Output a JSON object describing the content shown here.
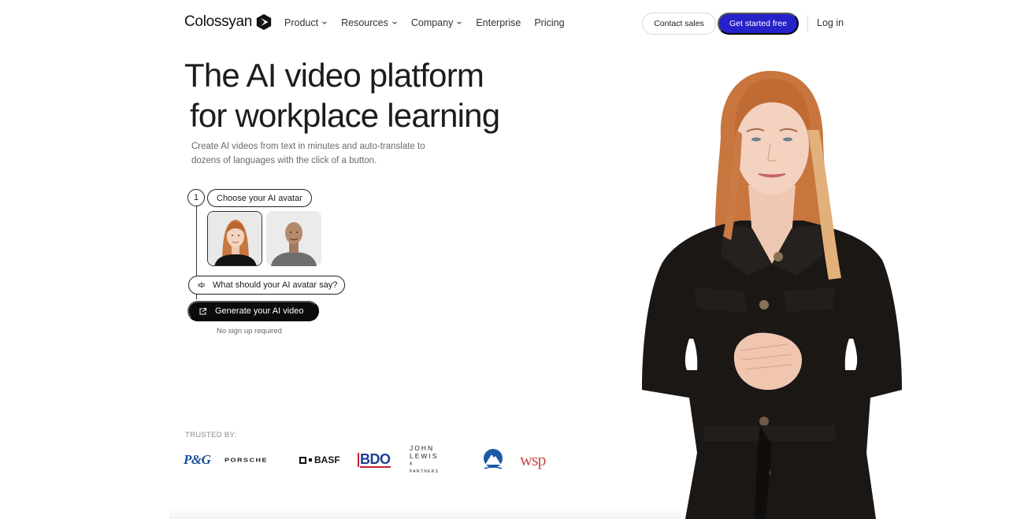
{
  "nav": {
    "brand": "Colossyan",
    "links": [
      {
        "label": "Product",
        "has_dropdown": true
      },
      {
        "label": "Resources",
        "has_dropdown": true
      },
      {
        "label": "Company",
        "has_dropdown": true
      },
      {
        "label": "Enterprise",
        "has_dropdown": false
      },
      {
        "label": "Pricing",
        "has_dropdown": false
      }
    ],
    "contact_sales": "Contact sales",
    "get_started": "Get started free",
    "login": "Log in"
  },
  "hero": {
    "title_line1": "The AI video platform",
    "title_line2": "for workplace learning",
    "subtitle": "Create AI videos from text in minutes and auto-translate to dozens of languages with the click of a button."
  },
  "demo": {
    "step_number": "1",
    "choose_label": "Choose your AI avatar",
    "avatars": [
      {
        "name": "female-avatar",
        "selected": true
      },
      {
        "name": "male-avatar",
        "selected": false
      }
    ],
    "prompt_placeholder": "What should your AI avatar say?",
    "generate_label": "Generate your AI video",
    "no_signup": "No sign up required"
  },
  "trusted": {
    "label": "TRUSTED BY:",
    "logos": {
      "pg": "P&G",
      "porsche": "PORSCHE",
      "basf": "BASF",
      "bdo": "BDO",
      "john_lewis": "JOHN LEWIS",
      "john_lewis_sub": "& PARTNERS",
      "paramount": "Paramount",
      "wsp": "wsp"
    }
  },
  "colors": {
    "accent": "#2622c9",
    "dark_button": "#0b0b0b",
    "text": "#1c1c1c",
    "muted": "#6a6a6a"
  }
}
